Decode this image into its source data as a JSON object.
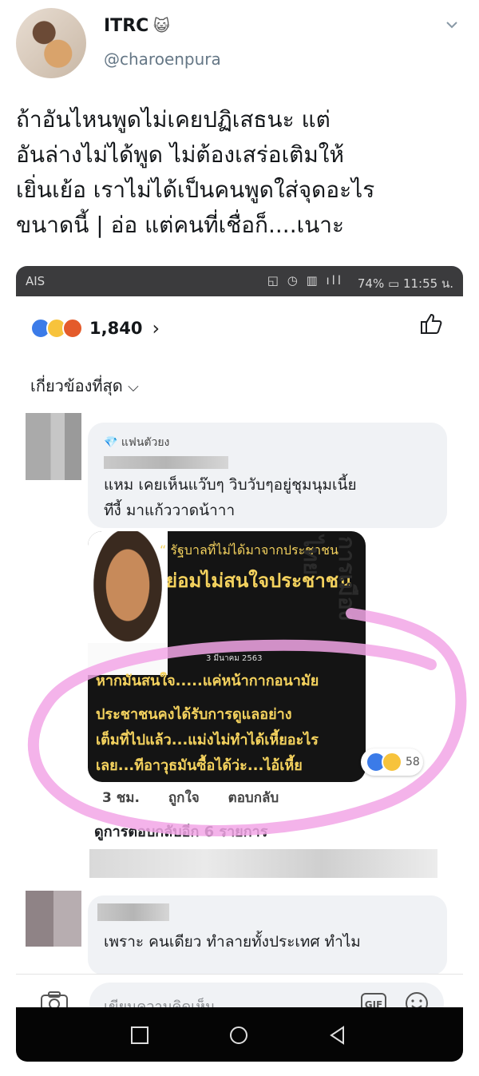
{
  "tweet": {
    "name": "ITRC",
    "name_emoji": "😺",
    "handle": "@charoenpura",
    "text_lines": [
      "ถ้าอันไหนพูดไม่เคยปฏิเสธนะ แต่",
      "อันล่างไม่ได้พูด ไม่ต้องเสร่อเติมให้",
      "เยิ่นเย้อ เราไม่ได้เป็นคนพูดใส่จุดอะไร",
      "ขนาดนี้ | อ่อ แต่คนที่เชื่อก็....เนาะ"
    ]
  },
  "phone": {
    "status": {
      "carrier": "AIS",
      "battery": "74%",
      "time": "11:55 น."
    },
    "reactions": {
      "count": "1,840"
    },
    "sort_label": "เกี่ยวข้องที่สุด",
    "comment1": {
      "badge": "แฟนตัวยง",
      "lines": [
        "แหม เคยเห็นแว๊บๆ วิบวับๆอยู่ชุมนุมเนี้ย",
        "ทีงี้ มาแก้ววาดน้าาา"
      ],
      "image": {
        "quote": "รัฐบาลที่ไม่ได้มาจากประชาชน",
        "headline": "ย่อมไม่สนใจประชาชน",
        "date": "3 มีนาคม 2563",
        "side": "การเมืองไทย",
        "text_lines": [
          "หากมันสนใจ.....แค่หน้ากากอนามัย",
          "ประชาชนคงได้รับการดูแลอย่าง",
          "เต็มที่ไปแล้ว...แม่งไม่ทำได้เหี้ยอะไร",
          "เลย...ทีอาวุธมันซื้อได้ว่ะ...ไอ้เหี้ย"
        ]
      },
      "reaction_count": "58",
      "time": "3 ชม.",
      "like_label": "ถูกใจ",
      "reply_label": "ตอบกลับ",
      "more_replies": "ดูการตอบกลับอีก 6 รายการ"
    },
    "comment2": {
      "line": "เพราะ คนเดียว ทำลายทั้งประเทศ ทำไม"
    },
    "input_placeholder": "เขียนความคิดเห็น...",
    "gif_label": "GIF"
  },
  "colors": {
    "accent_pink": "#f2a6e6",
    "facebook_blue": "#3b7be8",
    "meme_yellow": "#f4d25e"
  }
}
